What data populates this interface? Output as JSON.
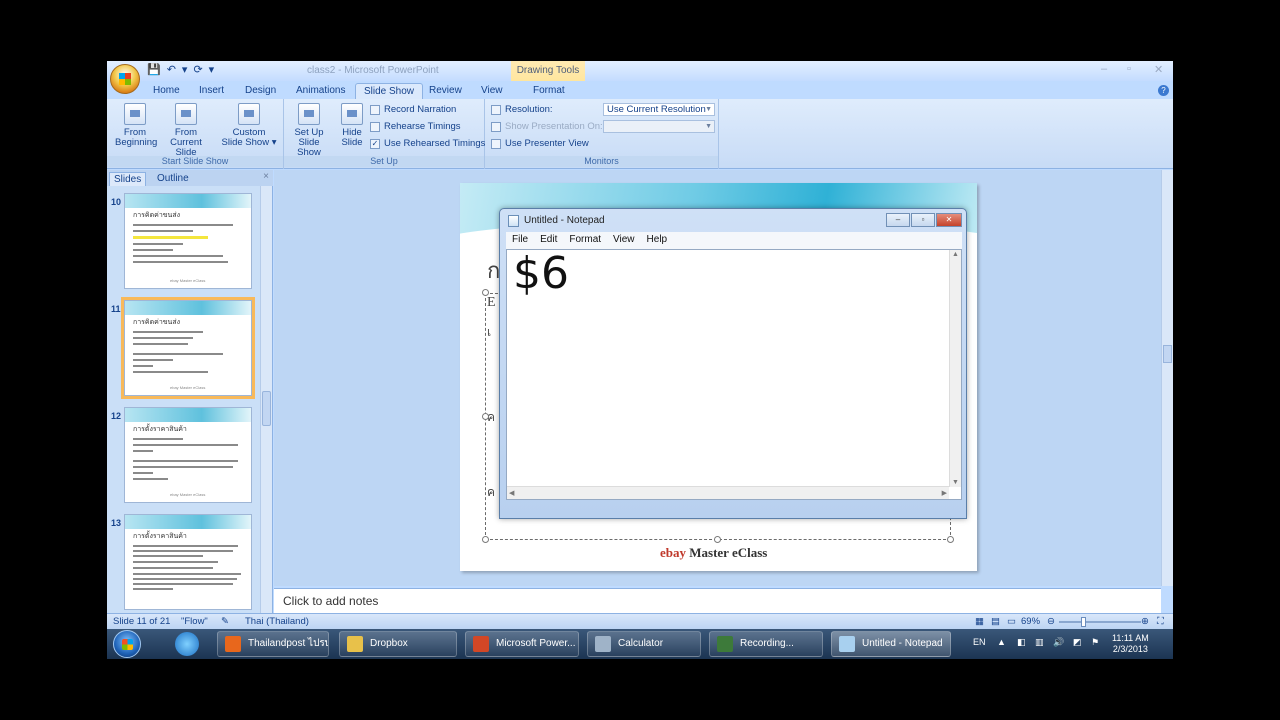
{
  "app": {
    "title": "class2 - Microsoft PowerPoint",
    "context_tab_group": "Drawing Tools",
    "qat_symbols": [
      "💾",
      "↶",
      "▾",
      "⟳",
      "▾"
    ],
    "window_controls": [
      "–",
      "▫",
      "✕"
    ]
  },
  "tabs": [
    "Home",
    "Insert",
    "Design",
    "Animations",
    "Slide Show",
    "Review",
    "View",
    "Format"
  ],
  "active_tab": "Slide Show",
  "ribbon": {
    "start_group": {
      "label": "Start Slide Show",
      "from_beginning": [
        "From",
        "Beginning"
      ],
      "from_current": [
        "From",
        "Current Slide"
      ],
      "custom": [
        "Custom",
        "Slide Show ▾"
      ]
    },
    "setup_group": {
      "label": "Set Up",
      "setup_show": [
        "Set Up",
        "Slide Show"
      ],
      "hide_slide": [
        "Hide",
        "Slide"
      ],
      "record_narration": "Record Narration",
      "rehearse_timings": "Rehearse Timings",
      "use_rehearsed": "Use Rehearsed Timings",
      "use_rehearsed_checked": "✓"
    },
    "monitors_group": {
      "label": "Monitors",
      "resolution_label": "Resolution:",
      "resolution_value": "Use Current Resolution",
      "show_on_label": "Show Presentation On:",
      "presenter_view": "Use Presenter View"
    }
  },
  "left_pane": {
    "tabs": [
      "Slides",
      "Outline"
    ],
    "close": "×",
    "slides": [
      {
        "num": "10",
        "title": "การคิดค่าขนส่ง"
      },
      {
        "num": "11",
        "title": "การคิดค่าขนส่ง"
      },
      {
        "num": "12",
        "title": "การตั้งราคาสินค้า"
      },
      {
        "num": "13",
        "title": "การตั้งราคาสินค้า"
      }
    ]
  },
  "slide": {
    "footer_ebay": "ebay",
    "footer_master": " Master ",
    "footer_eclass": "eClass"
  },
  "notepad": {
    "title": "Untitled - Notepad",
    "menu": [
      "File",
      "Edit",
      "Format",
      "View",
      "Help"
    ],
    "content": "$6"
  },
  "notes_placeholder": "Click to add notes",
  "status": {
    "slide_info": "Slide 11 of 21",
    "theme": "\"Flow\"",
    "language": "Thai (Thailand)",
    "zoom": "69%"
  },
  "taskbar": {
    "tasks": [
      {
        "label": "Thailandpost ไปรษ...",
        "color": "#e8671c"
      },
      {
        "label": "Dropbox",
        "color": "#e8c14a"
      },
      {
        "label": "Microsoft Power...",
        "color": "#d24726"
      },
      {
        "label": "Calculator",
        "color": "#9fb3c8"
      },
      {
        "label": "Recording...",
        "color": "#3d7a3a"
      },
      {
        "label": "Untitled - Notepad",
        "color": "#a8d0ef"
      }
    ],
    "lang": "EN",
    "time": "11:11 AM",
    "date": "2/3/2013"
  }
}
